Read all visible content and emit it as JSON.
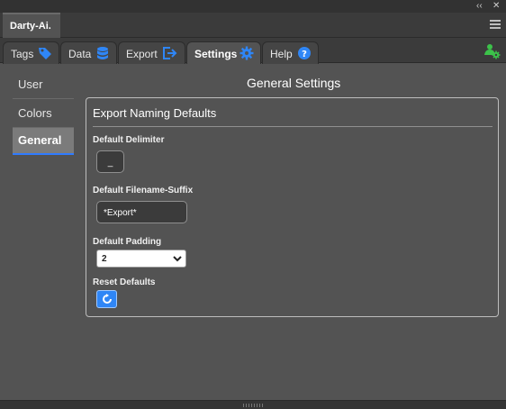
{
  "window": {
    "collapse_icon": "double-chevron-left-icon",
    "close_icon": "close-icon",
    "panel_title": "Darty-Ai.",
    "menu_icon": "hamburger-menu-icon"
  },
  "tabs": [
    {
      "label": "Tags",
      "icon": "tag-icon"
    },
    {
      "label": "Data",
      "icon": "database-icon"
    },
    {
      "label": "Export",
      "icon": "export-icon"
    },
    {
      "label": "Settings",
      "icon": "gear-icon",
      "active": true
    },
    {
      "label": "Help",
      "icon": "help-icon"
    }
  ],
  "user_settings_icon": "user-gear-icon",
  "sidebar": {
    "items": [
      {
        "label": "User"
      },
      {
        "label": "Colors"
      },
      {
        "label": "General",
        "active": true
      }
    ]
  },
  "main": {
    "title": "General Settings",
    "group_title": "Export Naming Defaults",
    "delimiter": {
      "label": "Default Delimiter",
      "value": "_"
    },
    "suffix": {
      "label": "Default Filename-Suffix",
      "value": "*Export*"
    },
    "padding": {
      "label": "Default Padding",
      "value": "2"
    },
    "reset": {
      "label": "Reset Defaults",
      "icon": "reset-icon"
    }
  },
  "colors": {
    "accent": "#2f86f6",
    "user_icon": "#3cc24a",
    "background": "#535353"
  }
}
